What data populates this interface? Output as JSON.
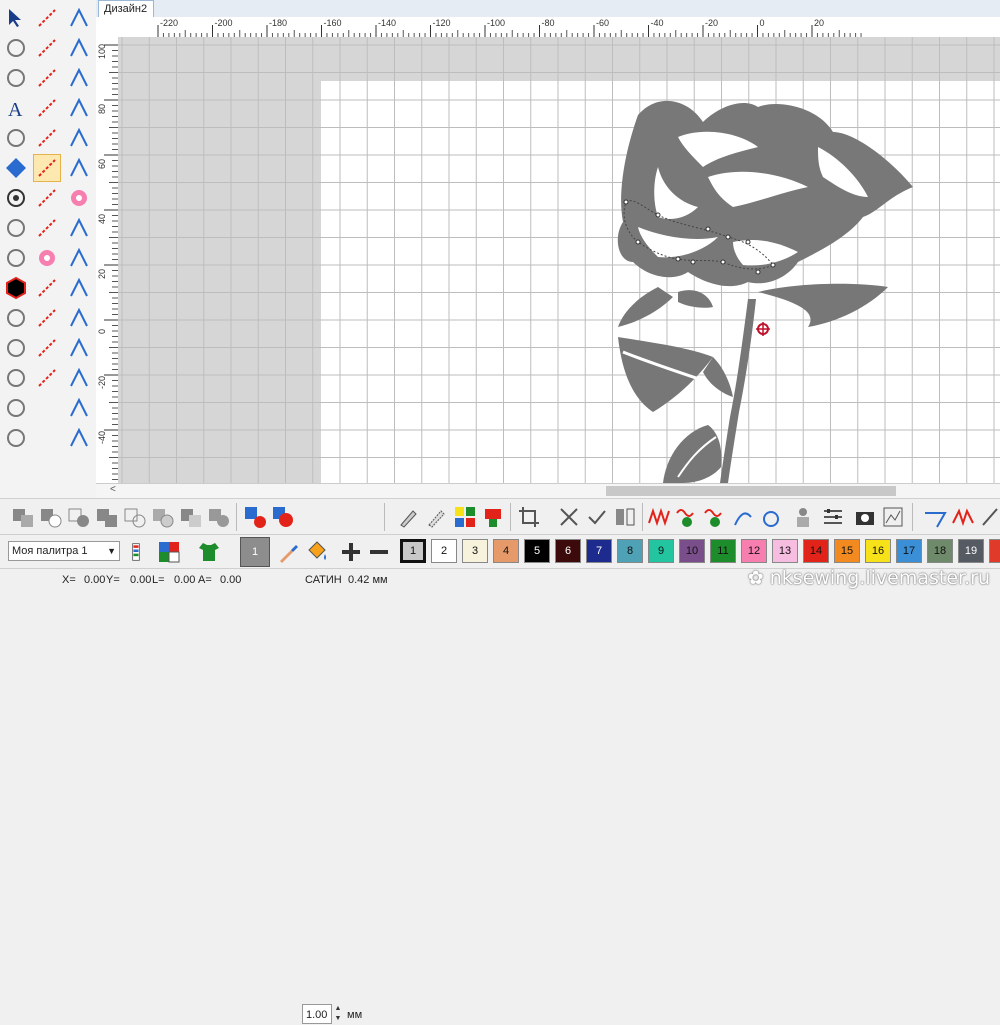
{
  "tab": {
    "title": "Дизайн2"
  },
  "ruler": {
    "h_labels": [
      "-220",
      "-200",
      "-180",
      "-160",
      "-140",
      "-120",
      "-100",
      "-80",
      "-60",
      "-40",
      "-20",
      "0",
      "20"
    ],
    "v_labels": [
      "100",
      "80",
      "60",
      "40",
      "20",
      "0",
      "-20",
      "-40"
    ]
  },
  "left_toolbar": {
    "col1": [
      "select-arrow-icon",
      "node-edit-icon",
      "rotate-view-icon",
      "text-icon",
      "people-lettering-icon",
      "monogram-icon",
      "circle-target-icon",
      "hexagon-icon",
      "hexagon-outline-icon",
      "hexagon-filled-icon",
      "hexagon-gray-icon",
      "pen-draw-icon",
      "dots-icon",
      "squares-icon",
      "square-overlap-icon"
    ],
    "col2": [
      "line-numbered-icon",
      "arc-line-icon",
      "ellipse-dashed-icon",
      "zigzag-line-icon",
      "polygon-icon",
      "curve-shape-icon",
      "corner-shape-icon",
      "split-shape-icon",
      "flower-star-icon",
      "circle-pattern-icon",
      "line-node-icon",
      "arrow-shape-icon",
      "cursor-pattern-icon"
    ],
    "col3": [
      "numbered-line-icon",
      "numbered-steps-icon",
      "red-fill-icon",
      "zigzag-red-icon",
      "zigzag-red2-icon",
      "satin-column-icon",
      "flower-pink-icon",
      "dashed-circle-icon",
      "heart-outline-icon",
      "crop-circle-icon",
      "arc-dashed-icon",
      "curve-node-icon",
      "needle-icon",
      "thread-icon",
      "spray-icon"
    ]
  },
  "toolbar": {
    "size_value": "1.00",
    "size_unit": "мм",
    "palette_name": "Моя палитра 1"
  },
  "colors": {
    "accent": "#2a6bd0",
    "rose": "#777777",
    "hoop": "#ffffff",
    "outside": "#d6d6d6"
  },
  "swatches": [
    {
      "label": "1",
      "color": "#c8c8c8",
      "text": "#111"
    },
    {
      "label": "2",
      "color": "#ffffff",
      "text": "#111"
    },
    {
      "label": "3",
      "color": "#f7f2dc",
      "text": "#111"
    },
    {
      "label": "4",
      "color": "#e69a6a",
      "text": "#111"
    },
    {
      "label": "5",
      "color": "#000000",
      "text": "#fff"
    },
    {
      "label": "6",
      "color": "#3c0a0a",
      "text": "#fff"
    },
    {
      "label": "7",
      "color": "#1e2b8e",
      "text": "#fff"
    },
    {
      "label": "8",
      "color": "#4fa1b5",
      "text": "#111"
    },
    {
      "label": "9",
      "color": "#22c5a0",
      "text": "#111"
    },
    {
      "label": "10",
      "color": "#7a4e8a",
      "text": "#111"
    },
    {
      "label": "11",
      "color": "#1d8c2a",
      "text": "#111"
    },
    {
      "label": "12",
      "color": "#f77fb0",
      "text": "#111"
    },
    {
      "label": "13",
      "color": "#f7bde0",
      "text": "#111"
    },
    {
      "label": "14",
      "color": "#e2231a",
      "text": "#111"
    },
    {
      "label": "15",
      "color": "#f28a1f",
      "text": "#111"
    },
    {
      "label": "16",
      "color": "#f7e21a",
      "text": "#111"
    },
    {
      "label": "17",
      "color": "#3a8fd6",
      "text": "#111"
    },
    {
      "label": "18",
      "color": "#6f8a6a",
      "text": "#111"
    },
    {
      "label": "19",
      "color": "#555a63",
      "text": "#fff"
    },
    {
      "label": "",
      "color": "#e03a2b",
      "text": "#111"
    }
  ],
  "status": {
    "x_label": "X=",
    "x_value": "0.00",
    "y_label": "Y=",
    "y_value": "0.00",
    "l_label": "L=",
    "l_value": "0.00",
    "a_label": "A=",
    "a_value": "0.00",
    "stitch": "САТИН",
    "stitch_value": "0.42 мм"
  },
  "watermark": "nksewing.livemaster.ru"
}
